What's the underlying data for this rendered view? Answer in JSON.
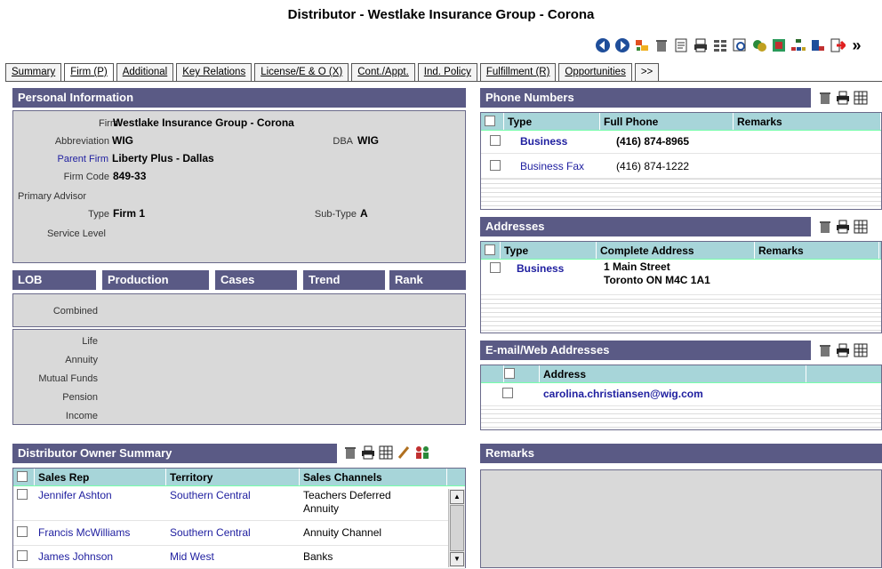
{
  "window_title": "Distributor - Westlake Insurance Group - Corona",
  "tabs": [
    {
      "label": "Summary"
    },
    {
      "label": "Firm (P)"
    },
    {
      "label": "Additional"
    },
    {
      "label": "Key Relations"
    },
    {
      "label": "License/E & O (X)"
    },
    {
      "label": "Cont./Appt."
    },
    {
      "label": "Ind. Policy"
    },
    {
      "label": "Fulfillment (R)"
    },
    {
      "label": "Opportunities"
    },
    {
      "label": ">>"
    }
  ],
  "personal_info": {
    "header": "Personal Information",
    "firm_label": "Firm",
    "firm": "Westlake Insurance Group - Corona",
    "abbrev_label": "Abbreviation",
    "abbrev": "WIG",
    "dba_label": "DBA",
    "dba": "WIG",
    "parent_label": "Parent Firm",
    "parent": "Liberty Plus - Dallas",
    "code_label": "Firm Code",
    "code": "849-33",
    "advisor_label": "Primary Advisor",
    "type_label": "Type",
    "type": "Firm 1",
    "subtype_label": "Sub-Type",
    "subtype": "A",
    "service_label": "Service Level"
  },
  "lob": {
    "headers": [
      "LOB",
      "Production",
      "Cases",
      "Trend",
      "Rank"
    ],
    "combined": "Combined",
    "lines": [
      "Life",
      "Annuity",
      "Mutual Funds",
      "Pension",
      "Income"
    ]
  },
  "owner_summary": {
    "header": "Distributor Owner Summary",
    "columns": [
      "Sales Rep",
      "Territory",
      "Sales Channels"
    ],
    "rows": [
      {
        "rep": "Jennifer Ashton",
        "territory": "Southern Central",
        "channel": "Teachers Deferred Annuity"
      },
      {
        "rep": "Francis McWilliams",
        "territory": "Southern Central",
        "channel": "Annuity Channel"
      },
      {
        "rep": "James Johnson",
        "territory": "Mid West",
        "channel": "Banks"
      }
    ]
  },
  "phones": {
    "header": "Phone Numbers",
    "columns": [
      "Type",
      "Full Phone",
      "Remarks"
    ],
    "rows": [
      {
        "type": "Business",
        "phone": "(416) 874-8965"
      },
      {
        "type": "Business Fax",
        "phone": "(416) 874-1222"
      }
    ]
  },
  "addresses": {
    "header": "Addresses",
    "columns": [
      "Type",
      "Complete Address",
      "Remarks"
    ],
    "rows": [
      {
        "type": "Business",
        "line1": "1 Main Street",
        "line2": "Toronto ON M4C 1A1"
      }
    ]
  },
  "emails": {
    "header": "E-mail/Web Addresses",
    "columns": [
      "Address"
    ],
    "rows": [
      {
        "address": "carolina.christiansen@wig.com"
      }
    ]
  },
  "remarks": {
    "header": "Remarks"
  },
  "icons": {
    "toolbar": [
      "back-icon",
      "forward-icon",
      "tag-icon",
      "trash-icon",
      "note-icon",
      "print-icon",
      "list-icon",
      "preview-icon",
      "merge-icon",
      "tree-icon",
      "hierarchy-icon",
      "report-icon",
      "exit-icon",
      "more-icon"
    ],
    "panel": [
      "trash-icon",
      "print-icon",
      "grid-icon"
    ]
  },
  "colors": {
    "header_bg": "#5a5a85",
    "grid_header_bg": "#a7d5d9",
    "link": "#2020a0",
    "panel_bg": "#d9d9d9"
  }
}
